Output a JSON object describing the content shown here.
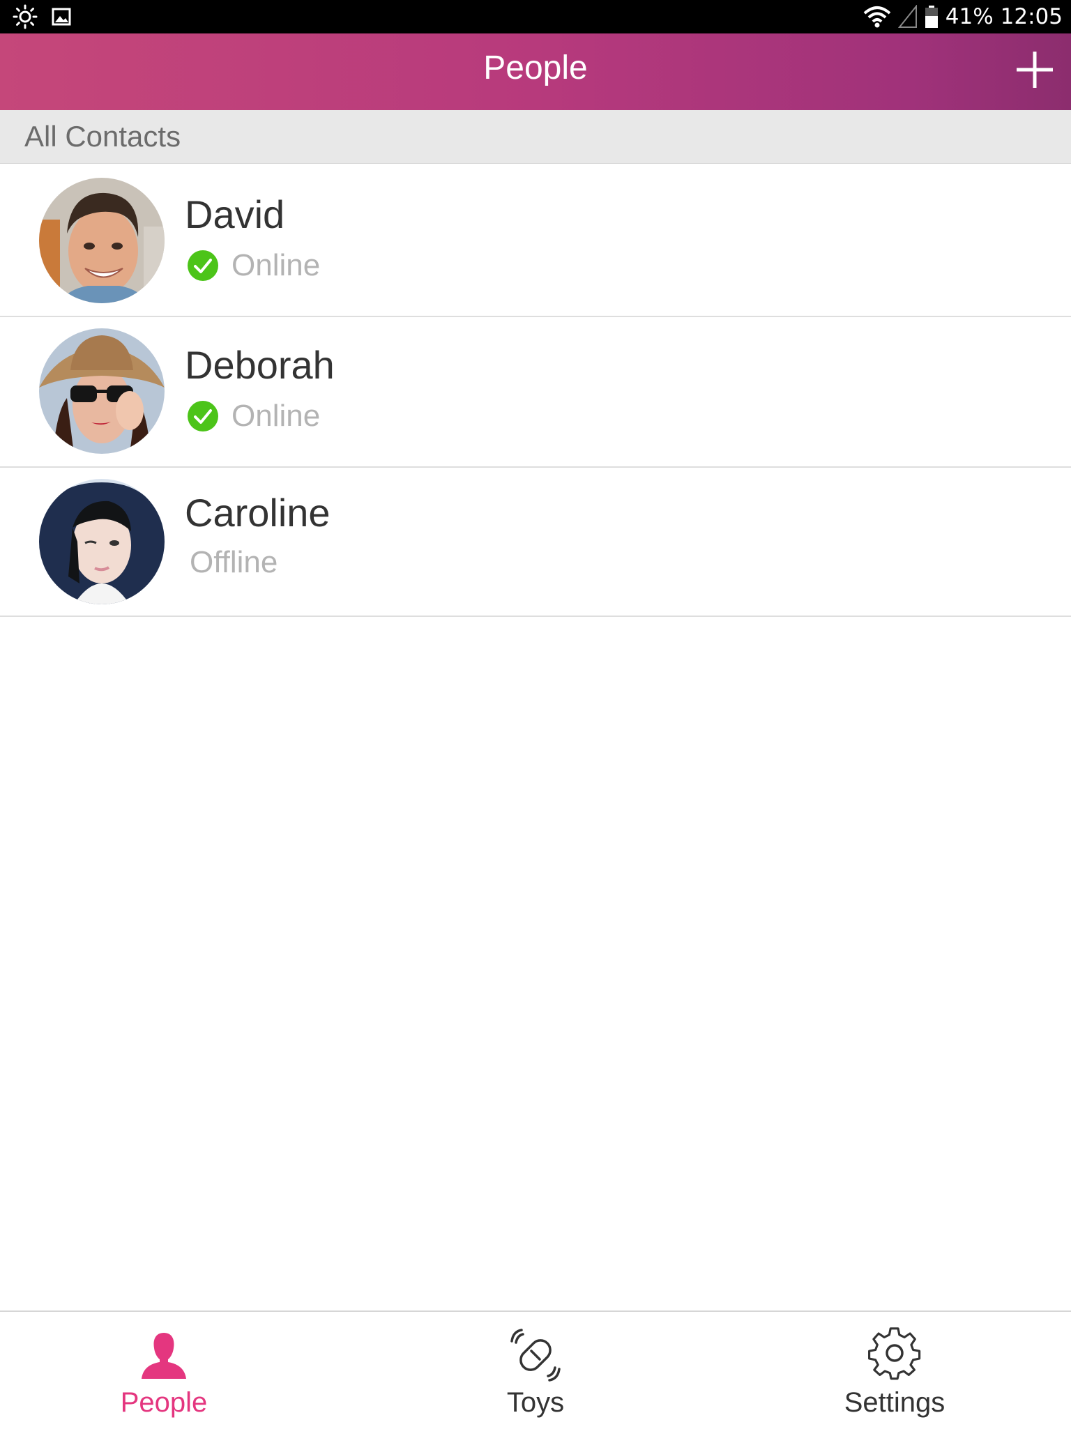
{
  "status_bar": {
    "battery_text": "41%",
    "clock": "12:05",
    "icons": [
      "brightness-icon",
      "image-icon",
      "wifi-icon",
      "signal-icon",
      "battery-icon"
    ]
  },
  "navbar": {
    "title": "People",
    "add_icon": "plus-icon",
    "gradient_colors": [
      "#c5477a",
      "#8c2d6e"
    ]
  },
  "section": {
    "label": "All Contacts"
  },
  "contacts": [
    {
      "name": "David",
      "status": "Online",
      "online": true,
      "avatar": "avatar-david"
    },
    {
      "name": "Deborah",
      "status": "Online",
      "online": true,
      "avatar": "avatar-deborah"
    },
    {
      "name": "Caroline",
      "status": "Offline",
      "online": false,
      "avatar": "avatar-caroline"
    }
  ],
  "tabs": [
    {
      "label": "People",
      "icon": "person-icon",
      "active": true
    },
    {
      "label": "Toys",
      "icon": "toy-icon",
      "active": false
    },
    {
      "label": "Settings",
      "icon": "gear-icon",
      "active": false
    }
  ],
  "colors": {
    "accent": "#e4367f",
    "online_green": "#4cc419",
    "status_gray": "#b3b3b3"
  }
}
